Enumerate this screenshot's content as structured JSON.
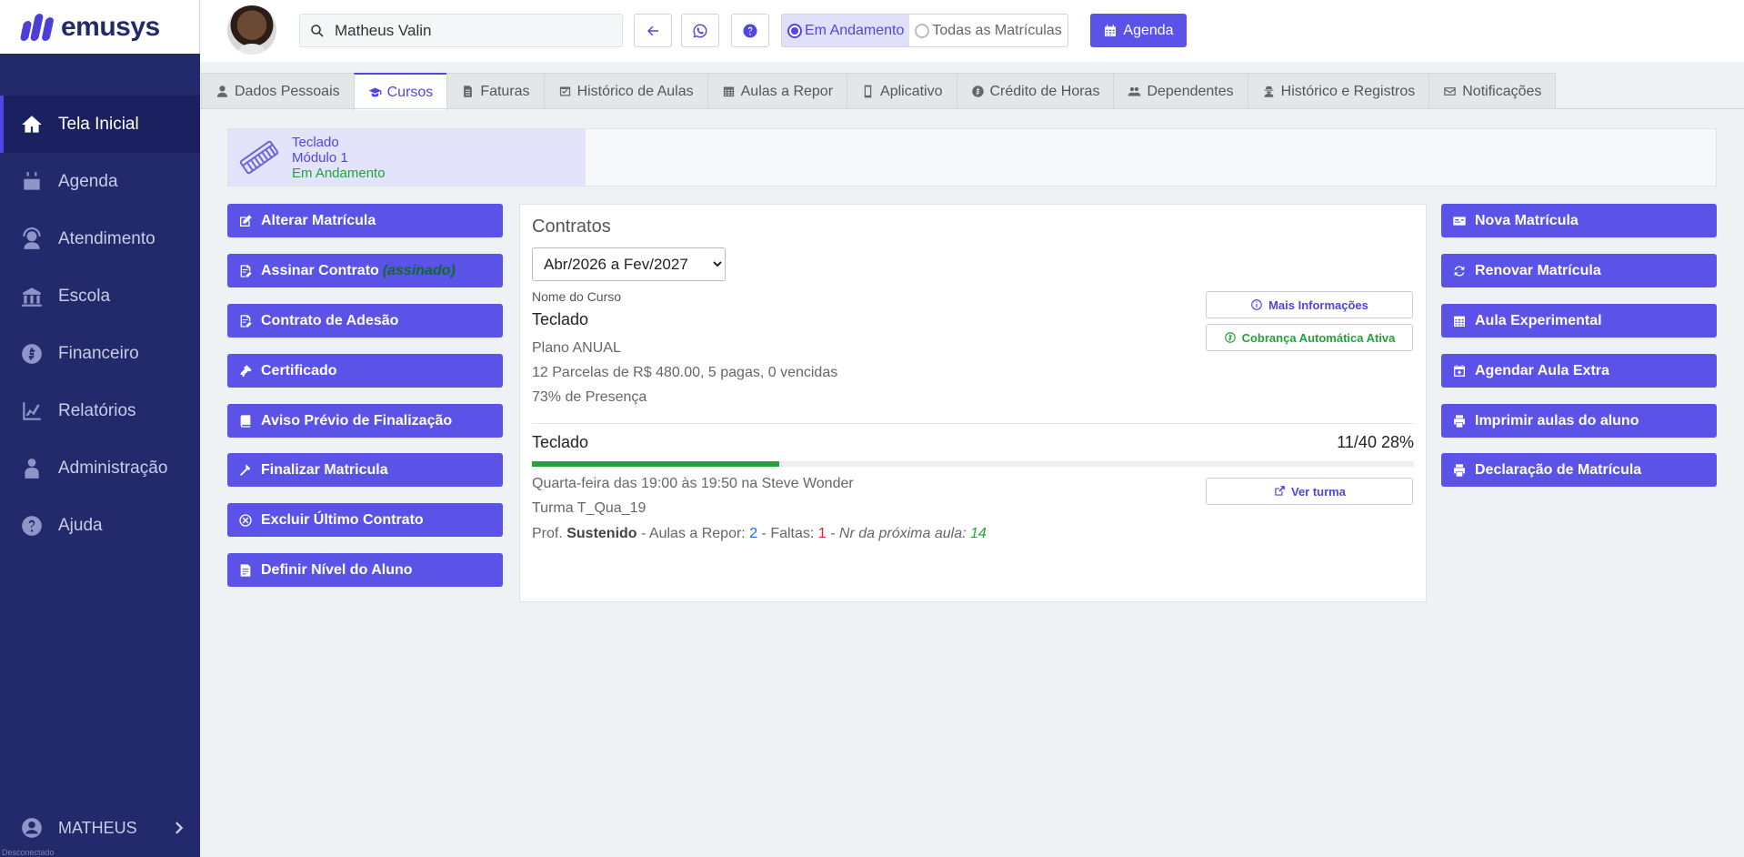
{
  "brand": {
    "name": "emusys"
  },
  "sidebar": {
    "items": [
      {
        "label": "Tela Inicial",
        "icon": "home-icon",
        "active": true
      },
      {
        "label": "Agenda",
        "icon": "calendar-icon"
      },
      {
        "label": "Atendimento",
        "icon": "headset-icon"
      },
      {
        "label": "Escola",
        "icon": "school-icon"
      },
      {
        "label": "Financeiro",
        "icon": "dollar-icon"
      },
      {
        "label": "Relatórios",
        "icon": "chart-icon"
      },
      {
        "label": "Administração",
        "icon": "admin-user-icon"
      },
      {
        "label": "Ajuda",
        "icon": "help-icon"
      }
    ],
    "user": "MATHEUS",
    "connection_status": "Desconectado"
  },
  "header": {
    "search_value": "Matheus Valin",
    "filter_options": [
      {
        "label": "Em Andamento",
        "selected": true
      },
      {
        "label": "Todas as Matrículas",
        "selected": false
      }
    ],
    "agenda_label": "Agenda"
  },
  "tabs": [
    {
      "label": "Dados Pessoais",
      "icon": "user-icon"
    },
    {
      "label": "Cursos",
      "icon": "graduation-cap-icon",
      "active": true
    },
    {
      "label": "Faturas",
      "icon": "invoice-icon"
    },
    {
      "label": "Histórico de Aulas",
      "icon": "history-icon"
    },
    {
      "label": "Aulas a Repor",
      "icon": "calendar-grid-icon"
    },
    {
      "label": "Aplicativo",
      "icon": "mobile-icon"
    },
    {
      "label": "Crédito de Horas",
      "icon": "coin-icon"
    },
    {
      "label": "Dependentes",
      "icon": "users-icon"
    },
    {
      "label": "Histórico e Registros",
      "icon": "user-secret-icon"
    },
    {
      "label": "Notificações",
      "icon": "envelope-icon"
    }
  ],
  "course_card": {
    "instrument": "Teclado",
    "module": "Módulo 1",
    "status": "Em Andamento"
  },
  "left_actions": [
    {
      "label": "Alterar Matrícula",
      "icon": "edit-icon"
    },
    {
      "label": "Assinar Contrato",
      "sub": "(assinado)",
      "icon": "signature-icon"
    },
    {
      "label": "Contrato de Adesão",
      "icon": "signature-icon"
    },
    {
      "label": "Certificado",
      "icon": "certificate-icon"
    },
    {
      "label": "Aviso Prévio de Finalização",
      "icon": "book-icon"
    },
    {
      "label": "Finalizar Matricula",
      "icon": "gavel-icon"
    },
    {
      "label": "Excluir Último Contrato",
      "icon": "circle-x-icon"
    },
    {
      "label": "Definir Nível do Aluno",
      "icon": "level-icon"
    }
  ],
  "right_actions": [
    {
      "label": "Nova Matrícula",
      "icon": "id-card-icon"
    },
    {
      "label": "Renovar Matrícula",
      "icon": "refresh-icon"
    },
    {
      "label": "Aula Experimental",
      "icon": "calendar-grid-icon"
    },
    {
      "label": "Agendar Aula Extra",
      "icon": "calendar-plus-icon"
    },
    {
      "label": "Imprimir aulas do aluno",
      "icon": "print-icon"
    },
    {
      "label": "Declaração de Matrícula",
      "icon": "print-icon"
    }
  ],
  "contract": {
    "title": "Contratos",
    "period_selected": "Abr/2026 a Fev/2027",
    "course_label": "Nome do Curso",
    "course_name": "Teclado",
    "plan": "Plano ANUAL",
    "installments": "12 Parcelas de R$ 480.00, 5 pagas, 0 vencidas",
    "attendance": "73% de Presença",
    "more_info_label": "Mais Informações",
    "auto_billing_label": "Cobrança Automática Ativa",
    "class_name": "Teclado",
    "progress_text": "11/40 28%",
    "progress_fraction": 0.28,
    "schedule": "Quarta-feira das 19:00 às 19:50 na Steve Wonder",
    "group": "Turma T_Qua_19",
    "teacher_prefix": "Prof. ",
    "teacher": "Sustenido",
    "replace_label": " - Aulas a Repor: ",
    "replace_count": "2",
    "absences_label": " - Faltas: ",
    "absences_count": "1",
    "next_label": " - Nr da próxima aula: ",
    "next_number": "14",
    "view_class_label": "Ver turma"
  },
  "colors": {
    "primary": "#5b53e8",
    "sidebar": "#232a6b",
    "success": "#22a33a"
  }
}
